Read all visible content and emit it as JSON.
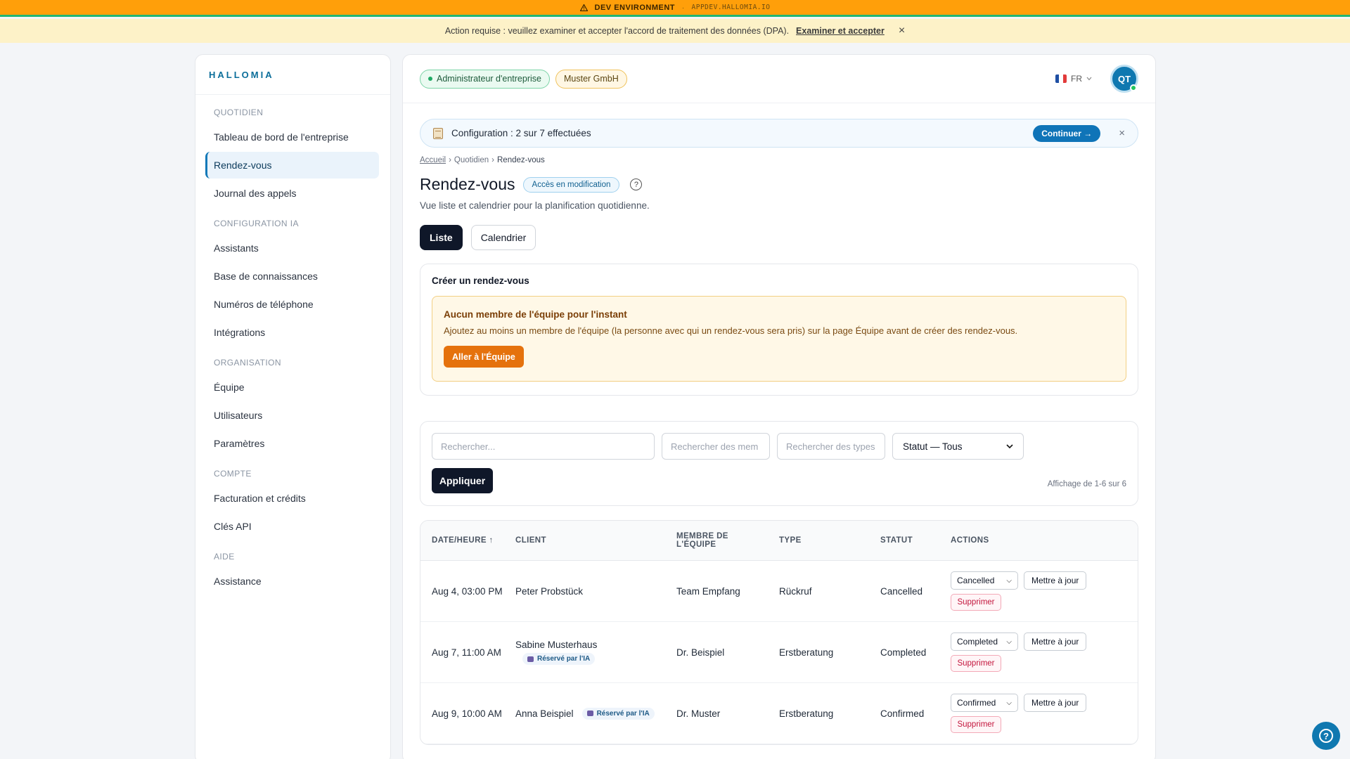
{
  "dev_bar": {
    "icon": "warning-icon",
    "label": "DEV ENVIRONMENT",
    "separator": "·",
    "host": "APPDEV.HALLOMIA.IO"
  },
  "dpa_bar": {
    "message": "Action requise : veuillez examiner et accepter l'accord de traitement des données (DPA).",
    "link": "Examiner et accepter",
    "close": "×"
  },
  "sidebar": {
    "brand": "HALLOMIA",
    "sections": [
      {
        "title": "QUOTIDIEN",
        "items": [
          "Tableau de bord de l'entreprise",
          "Rendez-vous",
          "Journal des appels"
        ]
      },
      {
        "title": "CONFIGURATION IA",
        "items": [
          "Assistants",
          "Base de connaissances",
          "Numéros de téléphone",
          "Intégrations"
        ]
      },
      {
        "title": "ORGANISATION",
        "items": [
          "Équipe",
          "Utilisateurs",
          "Paramètres"
        ]
      },
      {
        "title": "COMPTE",
        "items": [
          "Facturation et crédits",
          "Clés API"
        ]
      },
      {
        "title": "AIDE",
        "items": [
          "Assistance"
        ]
      }
    ],
    "active_item": "Rendez-vous"
  },
  "topbar": {
    "role": "Administrateur d'entreprise",
    "company": "Muster GmbH",
    "language": "FR",
    "flag_colors": [
      "#1f4fa3",
      "#ffffff",
      "#e23b3b"
    ],
    "avatar_initials": "QT"
  },
  "setup": {
    "text": "Configuration : 2 sur 7 effectuées",
    "cta": "Continuer →",
    "close": "×"
  },
  "breadcrumb": {
    "home": "Accueil",
    "sep": "›",
    "section": "Quotidien",
    "current": "Rendez-vous"
  },
  "page": {
    "title": "Rendez-vous",
    "access": "Accès en modification",
    "help": "?",
    "subtitle": "Vue liste et calendrier pour la planification quotidienne."
  },
  "tabs": {
    "list": "Liste",
    "calendar": "Calendrier",
    "active": "Liste"
  },
  "create": {
    "title": "Créer un rendez-vous",
    "warning_title": "Aucun membre de l'équipe pour l'instant",
    "warning_text": "Ajoutez au moins un membre de l'équipe (la personne avec qui un rendez-vous sera pris) sur la page Équipe avant de créer des rendez-vous.",
    "warning_button": "Aller à l'Équipe"
  },
  "filters": {
    "search_placeholder": "Rechercher...",
    "member_placeholder": "Rechercher des mem",
    "type_placeholder": "Rechercher des types",
    "status_value": "Statut — Tous",
    "apply": "Appliquer",
    "showing": "Affichage de 1-6 sur 6"
  },
  "table": {
    "headers": {
      "date": "DATE/HEURE ↑",
      "client": "CLIENT",
      "member_1": "MEMBRE DE",
      "member_2": "L'ÉQUIPE",
      "type": "TYPE",
      "status": "STATUT",
      "actions": "ACTIONS"
    },
    "ai_badge": "Réservé par l'IA",
    "update_label": "Mettre à jour",
    "delete_label": "Supprimer",
    "rows": [
      {
        "date": "Aug 4, 03:00 PM",
        "client": "Peter Probstück",
        "member": "Team Empfang",
        "type": "Rückruf",
        "status": "Cancelled",
        "select": "Cancelled"
      },
      {
        "date": "Aug 7, 11:00 AM",
        "client": "Sabine Musterhaus",
        "member": "Dr. Beispiel",
        "type": "Erstberatung",
        "status": "Completed",
        "select": "Completed"
      },
      {
        "date": "Aug 9, 10:00 AM",
        "client": "Anna Beispiel",
        "member": "Dr. Muster",
        "type": "Erstberatung",
        "status": "Confirmed",
        "select": "Confirmed"
      }
    ]
  },
  "help_fab": "?"
}
